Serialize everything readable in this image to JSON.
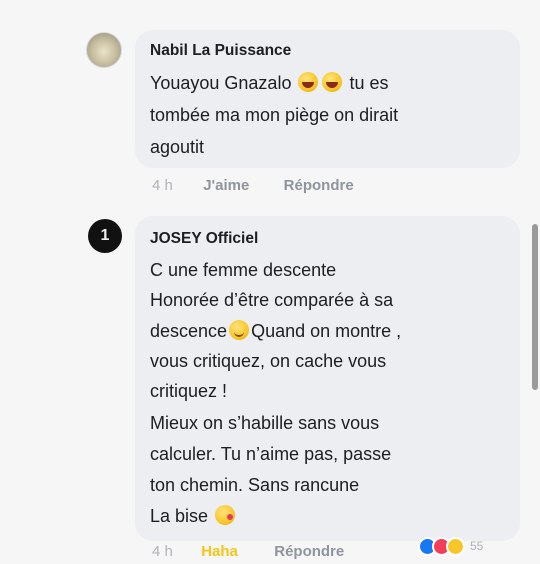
{
  "comments": [
    {
      "author": "Nabil La Puissance",
      "lines": [
        {
          "text": "Youayou Gnazalo",
          "after_emoji": "tu es"
        },
        {
          "text": "tombée ma mon piège on dirait"
        },
        {
          "text": "agoutit"
        }
      ],
      "emoji_icons": [
        "laughing-face-icon",
        "laughing-face-icon"
      ],
      "time": "4 h",
      "like_label": "J'aime",
      "reply_label": "Répondre"
    },
    {
      "author": "JOSEY Officiel",
      "avatar_glyph": "1",
      "lines": [
        {
          "text": "C une femme descente"
        },
        {
          "text": "Honorée d’être comparée à sa"
        },
        {
          "text": "descence",
          "after_emoji": "Quand on montre ,"
        },
        {
          "text": "vous critiquez, on cache vous"
        },
        {
          "text": "critiquez !"
        },
        {
          "text": "Mieux on s’habille sans vous"
        },
        {
          "text": "calculer. Tu n’aime pas, passe"
        },
        {
          "text": "ton chemin. Sans rancune"
        },
        {
          "text": "La bise"
        }
      ],
      "emoji_icons": [
        "smiling-face-icon",
        "kissing-face-icon"
      ],
      "time": "4 h",
      "like_label": "Haha",
      "reply_label": "Répondre",
      "reaction_count": "55",
      "reaction_icons": [
        "like-reaction-icon",
        "love-reaction-icon",
        "haha-reaction-icon"
      ]
    }
  ],
  "colors": {
    "bubble": "#eceef1",
    "haha_label": "#f5c518",
    "muted_text": "#90949c"
  }
}
